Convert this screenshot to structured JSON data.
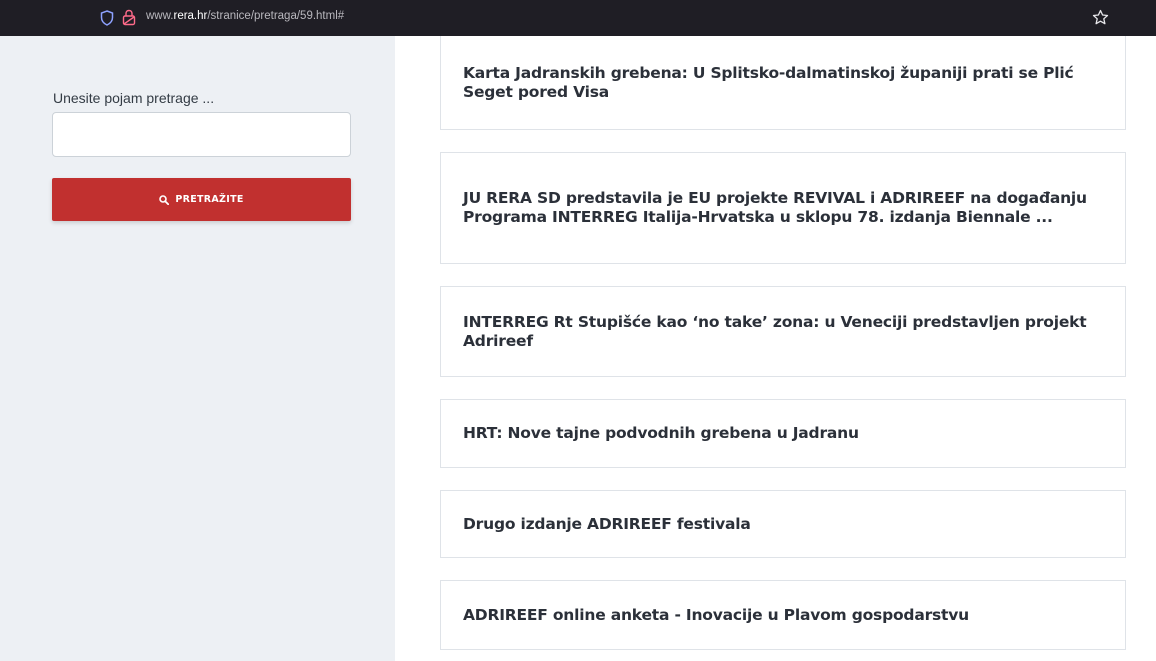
{
  "browser": {
    "url_prefix": "www.",
    "url_host": "rera.hr",
    "url_path": "/stranice/pretraga/59.html#"
  },
  "sidebar": {
    "search_label": "Unesite pojam pretrage ...",
    "search_value": "",
    "search_button_label": "PRETRAŽITE",
    "search_button_color": "#c1302f"
  },
  "results": [
    {
      "title": "Karta Jadranskih grebena: U Splitsko-dalmatinskoj županiji prati se Plić Seget pored Visa"
    },
    {
      "title": "JU RERA SD predstavila je EU projekte REVIVAL i ADRIREEF na događanju Programa INTERREG Italija-Hrvatska u sklopu 78. izdanja Biennale ..."
    },
    {
      "title": "INTERREG Rt Stupišće kao ‘no take’ zona: u Veneciji predstavljen projekt Adrireef"
    },
    {
      "title": "HRT: Nove tajne podvodnih grebena u Jadranu"
    },
    {
      "title": "Drugo izdanje ADRIREEF festivala"
    },
    {
      "title": "ADRIREEF online anketa - Inovacije u Plavom gospodarstvu"
    }
  ],
  "icons": {
    "shield": "shield-icon",
    "lock": "lock-icon",
    "star": "bookmark-star-icon",
    "search": "search-icon"
  }
}
